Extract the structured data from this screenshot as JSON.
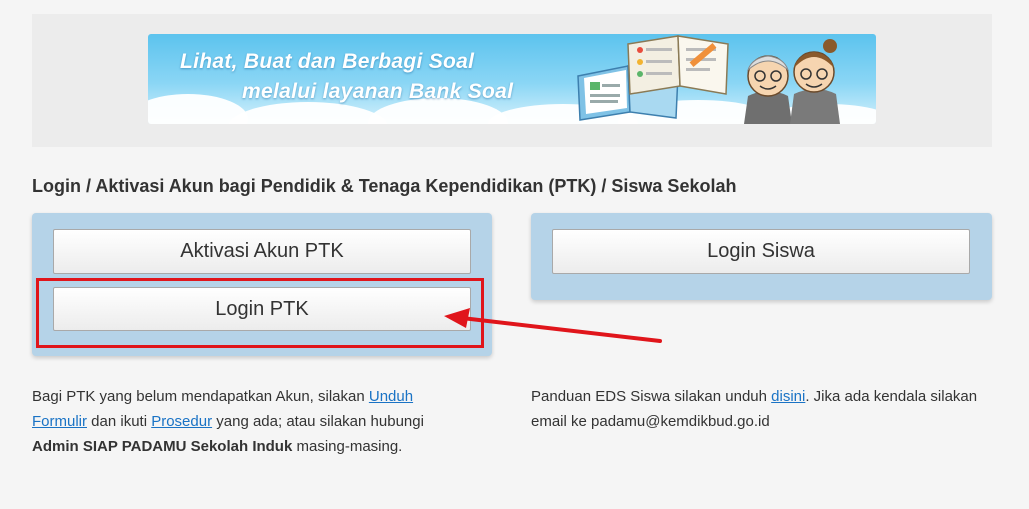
{
  "banner": {
    "line1": "Lihat, Buat dan Berbagi Soal",
    "line2": "melalui layanan Bank Soal"
  },
  "section_title": "Login / Aktivasi Akun bagi Pendidik & Tenaga Kependidikan (PTK) / Siswa Sekolah",
  "buttons": {
    "aktivasi": "Aktivasi Akun PTK",
    "login_ptk": "Login PTK",
    "login_siswa": "Login Siswa"
  },
  "info_left": {
    "text1": "Bagi PTK yang belum mendapatkan Akun, silakan ",
    "link1": "Unduh Formulir",
    "text2": " dan ikuti ",
    "link2": "Prosedur",
    "text3": " yang ada; atau silakan hubungi ",
    "bold": "Admin SIAP PADAMU Sekolah Induk",
    "text4": " masing-masing."
  },
  "info_right": {
    "text1": "Panduan EDS Siswa silakan unduh ",
    "link1": "disini",
    "text2": ". Jika ada kendala silakan email ke padamu@kemdikbud.go.id"
  },
  "colors": {
    "panel": "#b5d3e8",
    "link": "#1a73c5",
    "highlight": "#e0151b"
  }
}
